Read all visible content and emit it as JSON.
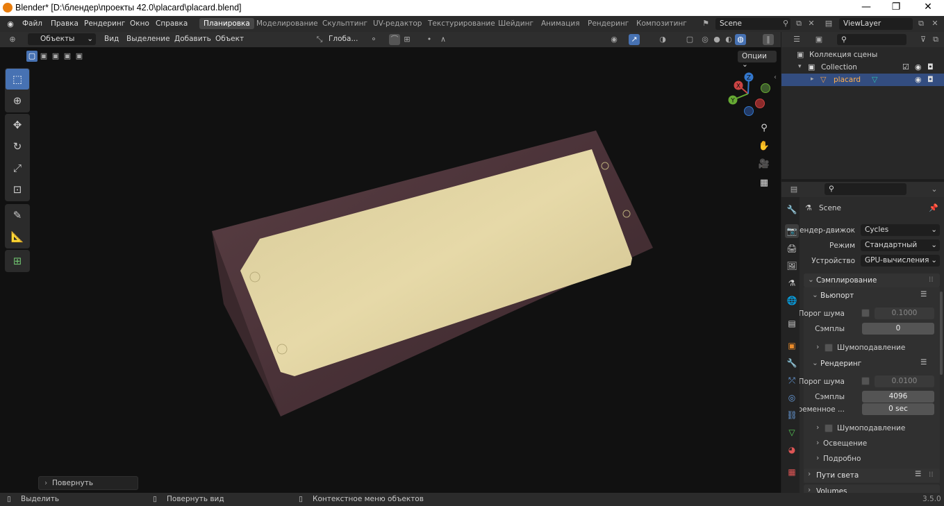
{
  "window": {
    "title": "Blender* [D:\\блендер\\проекты 42.0\\placard\\placard.blend]",
    "controls": [
      "—",
      "❐",
      "✕"
    ]
  },
  "topbar": {
    "menus": [
      "Файл",
      "Правка",
      "Рендеринг",
      "Окно",
      "Справка"
    ],
    "workspaces": [
      "Планировка",
      "Моделирование",
      "Скульптинг",
      "UV-редактор",
      "Текстурирование",
      "Шейдинг",
      "Анимация",
      "Рендеринг",
      "Композитинг"
    ],
    "active_workspace": "Планировка",
    "scene": "Scene",
    "view_layer": "ViewLayer"
  },
  "viewport_header": {
    "mode": "Объекты",
    "menus": [
      "Вид",
      "Выделение",
      "Добавить",
      "Объект"
    ],
    "transform_orientation": "Глоба...",
    "options": "Опции"
  },
  "viewport": {
    "last_operator": "Повернуть",
    "gizmo_axes": [
      "X",
      "Y",
      "Z"
    ]
  },
  "outliner": {
    "scene_collection": "Коллекция сцены",
    "collection": "Collection",
    "object": "placard"
  },
  "properties": {
    "context": "Scene",
    "render_engine_label": "Рендер-движок",
    "render_engine": "Cycles",
    "mode_label": "Режим",
    "mode": "Стандартный",
    "device_label": "Устройство",
    "device": "GPU-вычисления",
    "sampling": "Сэмплирование",
    "viewport_section": "Вьюпорт",
    "noise_threshold_label": "Порог шума",
    "viewport_noise_threshold": "0.1000",
    "samples_label": "Сэмплы",
    "viewport_samples": "0",
    "denoise_label": "Шумоподавление",
    "render_section": "Рендеринг",
    "render_noise_threshold": "0.0100",
    "render_samples": "4096",
    "time_limit_label": "Временное ...",
    "time_limit": "0 sec",
    "lights": "Освещение",
    "advanced": "Подробно",
    "light_paths": "Пути света",
    "volumes": "Volumes"
  },
  "statusbar": {
    "select": "Выделить",
    "rotate_view": "Повернуть вид",
    "context_menu": "Контекстное меню объектов",
    "version": "3.5.0"
  }
}
